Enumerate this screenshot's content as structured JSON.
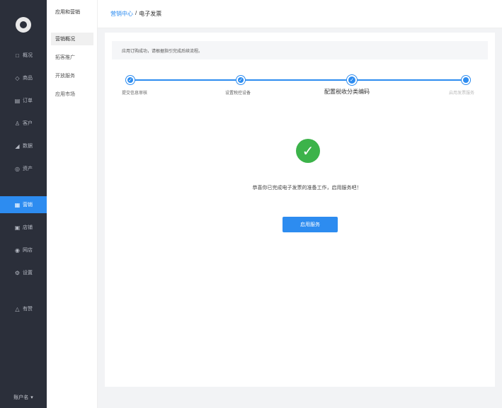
{
  "sidebar": {
    "logo_icon": "logo-icon",
    "items": [
      {
        "label": "概况",
        "icon": "□"
      },
      {
        "label": "商品",
        "icon": "◇"
      },
      {
        "label": "订单",
        "icon": "▤"
      },
      {
        "label": "客户",
        "icon": "♙"
      },
      {
        "label": "数据",
        "icon": "◢"
      },
      {
        "label": "资产",
        "icon": "◎"
      },
      {
        "label": "营销",
        "icon": "▦"
      },
      {
        "label": "店铺",
        "icon": "▣"
      },
      {
        "label": "网店",
        "icon": "◉"
      },
      {
        "label": "设置",
        "icon": "⚙"
      },
      {
        "label": "有赞",
        "icon": "△"
      }
    ],
    "store_switch": {
      "label": "账户名",
      "icon": "▾"
    }
  },
  "submenu": {
    "title": "应用和营销",
    "items": [
      "营销概况",
      "拓客推广",
      "开放服务",
      "应用市场"
    ]
  },
  "breadcrumb": {
    "link": "营销中心",
    "separator": "/",
    "current": "电子发票"
  },
  "notice": "应用订购成功，请根据指引完成后续流程。",
  "steps": [
    {
      "label": "提交信息审核",
      "state": "done"
    },
    {
      "label": "设置税控设备",
      "state": "done"
    },
    {
      "label": "配置税收分类编码",
      "state": "current"
    },
    {
      "label": "启用发票服务",
      "state": "future"
    }
  ],
  "success": {
    "message": "恭喜你已完成电子发票的准备工作，启用服务吧！",
    "button": "启用服务"
  },
  "colors": {
    "sidebar_bg": "#2b2f3a",
    "accent": "#2d8cf0",
    "success": "#3cb34a",
    "content_bg": "#f2f3f5"
  }
}
